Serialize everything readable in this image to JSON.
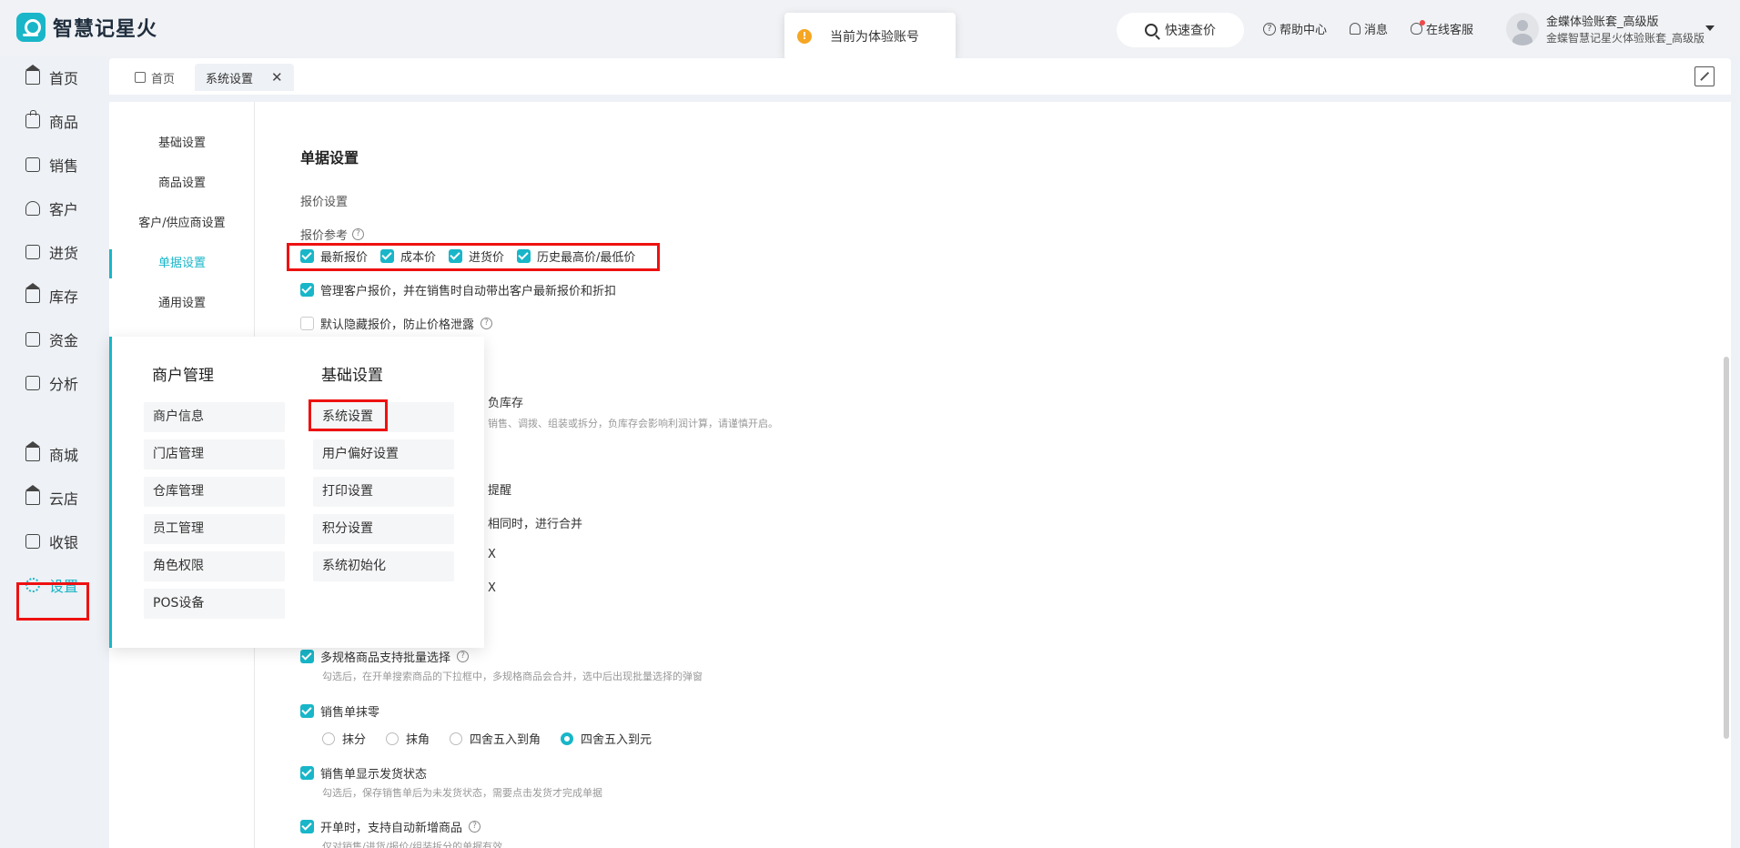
{
  "app": {
    "name": "智慧记星火"
  },
  "toast": {
    "text": "当前为体验账号"
  },
  "header": {
    "quick_search": "快速查价",
    "help": "帮助中心",
    "messages": "消息",
    "service": "在线客服",
    "user_name": "金蝶体验账套_高级版",
    "user_sub": "金蝶智慧记星火体验账套_高级版"
  },
  "nav": {
    "items": [
      {
        "label": "首页"
      },
      {
        "label": "商品"
      },
      {
        "label": "销售"
      },
      {
        "label": "客户"
      },
      {
        "label": "进货"
      },
      {
        "label": "库存"
      },
      {
        "label": "资金"
      },
      {
        "label": "分析"
      },
      {
        "label": "商城"
      },
      {
        "label": "云店"
      },
      {
        "label": "收银"
      },
      {
        "label": "设置"
      }
    ]
  },
  "tabs": [
    {
      "label": "首页"
    },
    {
      "label": "系统设置"
    }
  ],
  "subnav": {
    "items": [
      {
        "label": "基础设置"
      },
      {
        "label": "商品设置"
      },
      {
        "label": "客户/供应商设置"
      },
      {
        "label": "单据设置"
      },
      {
        "label": "通用设置"
      }
    ]
  },
  "content": {
    "section_title": "单据设置",
    "quote_settings": "报价设置",
    "quote_ref": "报价参考",
    "quote_options": [
      "最新报价",
      "成本价",
      "进货价",
      "历史最高价/最低价"
    ],
    "manage_quote": "管理客户报价，并在销售时自动带出客户最新报价和折扣",
    "hide_quote": "默认隐藏报价，防止价格泄露",
    "neg_stock_tail": "负库存",
    "neg_stock_hint_tail": "销售、调拨、组装或拆分，负库存会影响利润计算，请谨慎开启。",
    "remind_tail": "提醒",
    "merge_tail": "相同时，进行合并",
    "frag_1": "X",
    "frag_2": "X",
    "multi_spec": "多规格商品支持批量选择",
    "multi_spec_hint": "勾选后，在开单搜索商品的下拉框中，多规格商品会合并，选中后出现批量选择的弹窗",
    "round_off": "销售单抹零",
    "round_options": [
      "抹分",
      "抹角",
      "四舍五入到角",
      "四舍五入到元"
    ],
    "ship_status": "销售单显示发货状态",
    "ship_hint": "勾选后，保存销售单后为未发货状态，需要点击发货才完成单据",
    "auto_add": "开单时，支持自动新增商品",
    "auto_add_hint": "仅对销售/进货/报价/组装拆分的单据有效"
  },
  "popup": {
    "col1_title": "商户管理",
    "col1_items": [
      "商户信息",
      "门店管理",
      "仓库管理",
      "员工管理",
      "角色权限",
      "POS设备"
    ],
    "col2_title": "基础设置",
    "col2_items": [
      "系统设置",
      "用户偏好设置",
      "打印设置",
      "积分设置",
      "系统初始化"
    ]
  },
  "colors": {
    "accent": "#18b6c8",
    "highlight": "#ee1111"
  }
}
